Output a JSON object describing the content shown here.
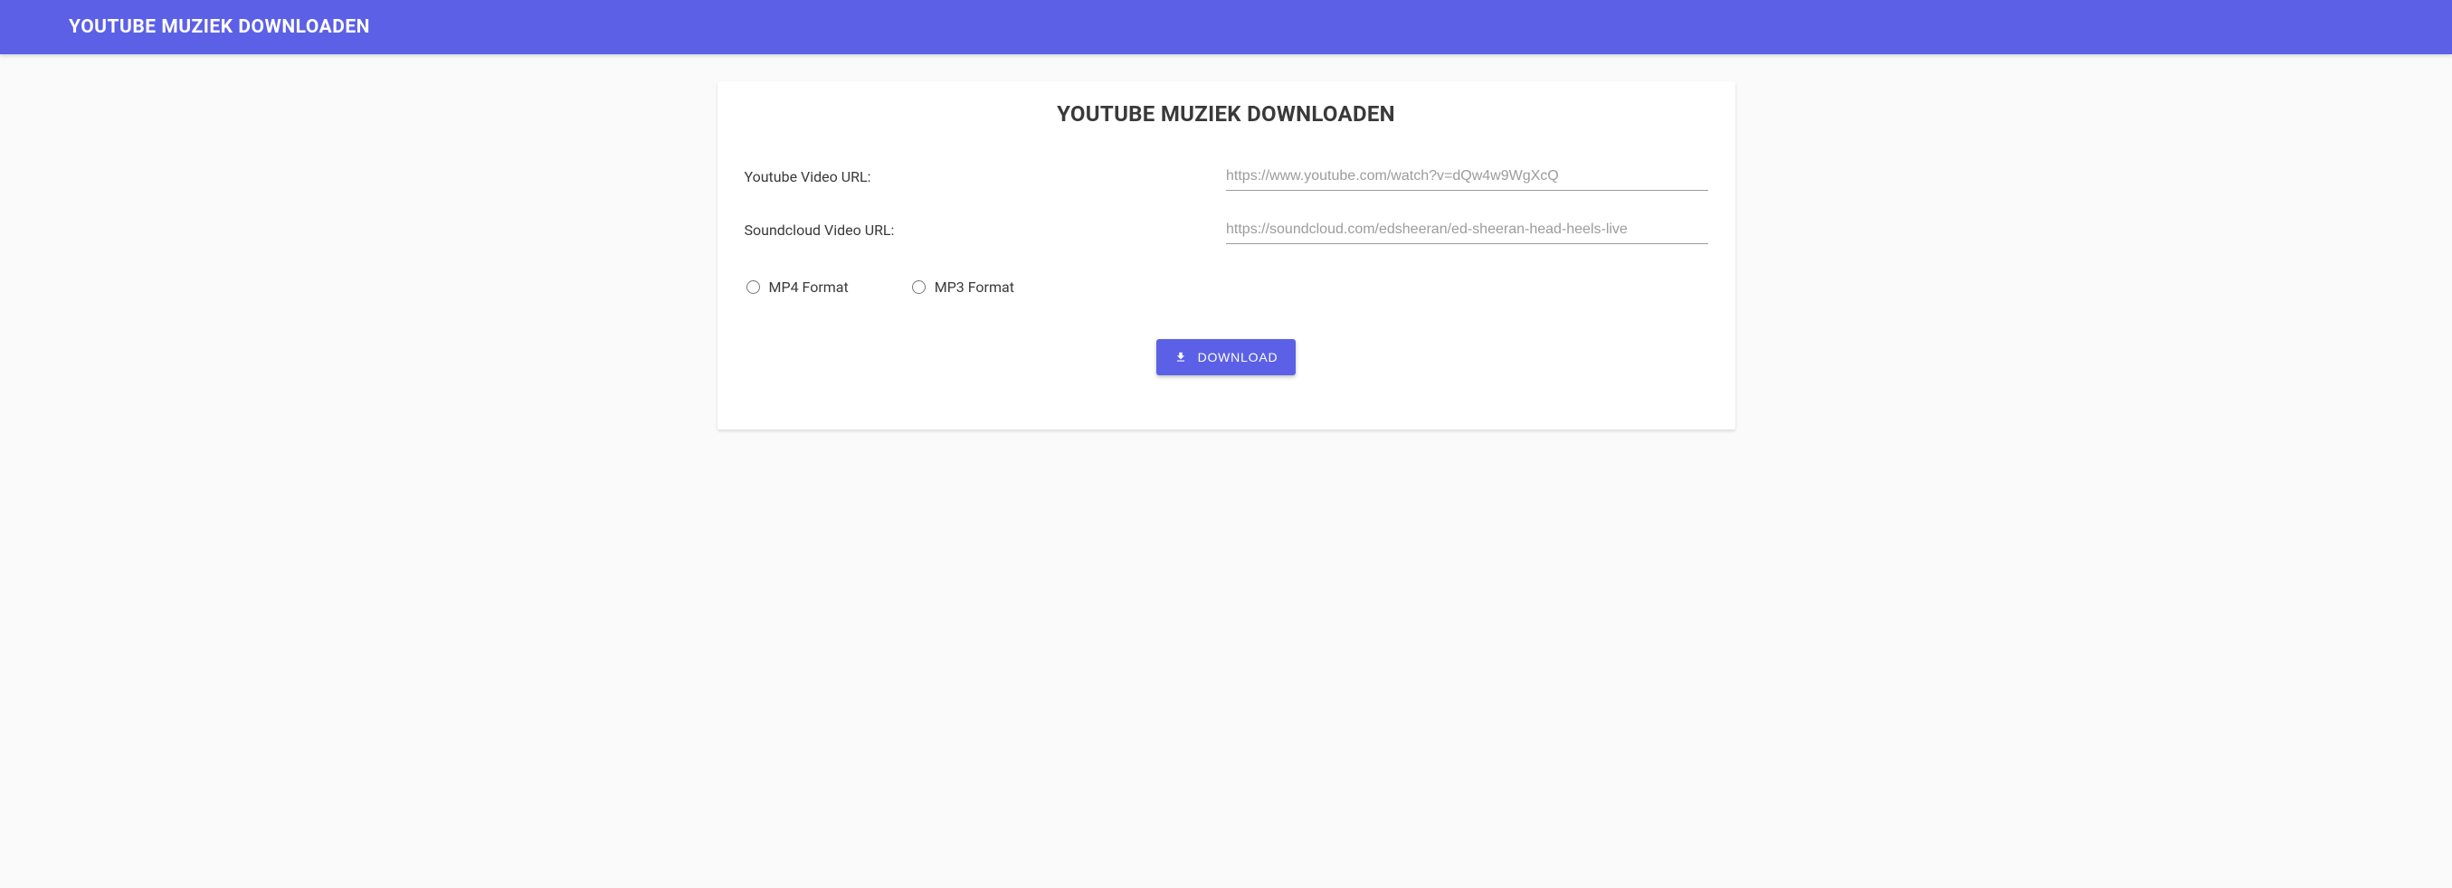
{
  "header": {
    "title": "YOUTUBE MUZIEK DOWNLOADEN"
  },
  "card": {
    "title": "YOUTUBE MUZIEK DOWNLOADEN"
  },
  "form": {
    "youtube": {
      "label": "Youtube Video URL:",
      "placeholder": "https://www.youtube.com/watch?v=dQw4w9WgXcQ",
      "value": ""
    },
    "soundcloud": {
      "label": "Soundcloud Video URL:",
      "placeholder": "https://soundcloud.com/edsheeran/ed-sheeran-head-heels-live",
      "value": ""
    },
    "formats": {
      "mp4": "MP4 Format",
      "mp3": "MP3 Format"
    },
    "download_button": "DOWNLOAD"
  }
}
